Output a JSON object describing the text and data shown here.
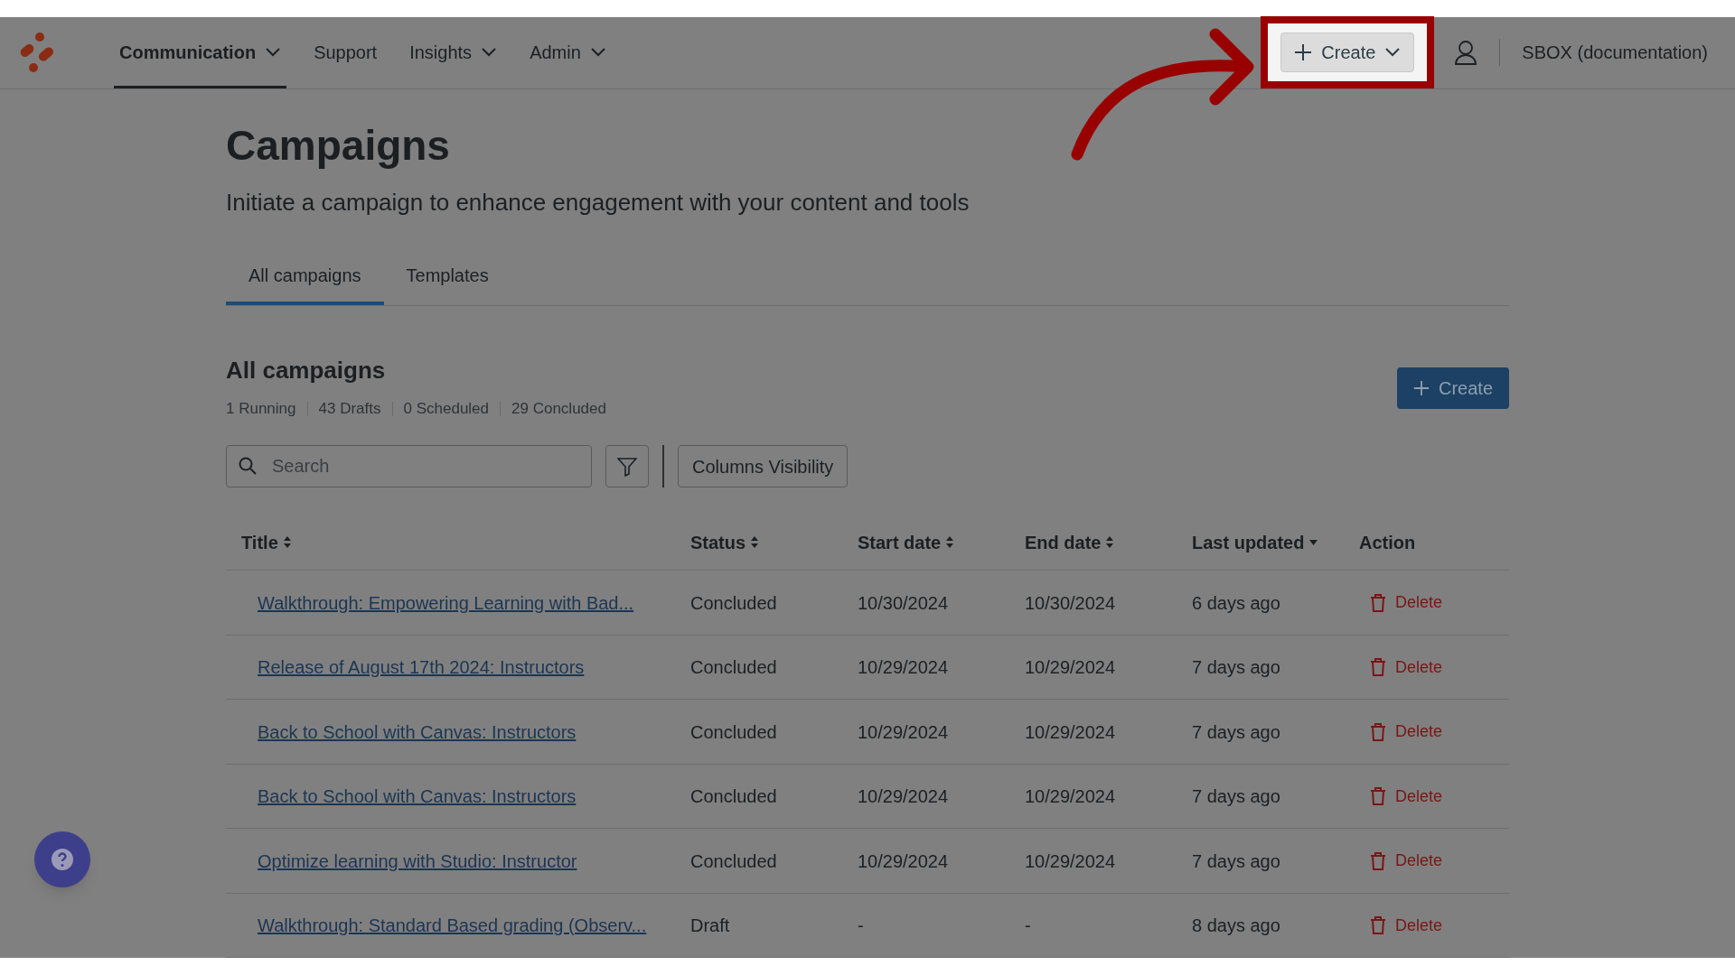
{
  "nav": {
    "items": [
      {
        "label": "Communication",
        "selected": true,
        "dropdown": true
      },
      {
        "label": "Support",
        "selected": false,
        "dropdown": false
      },
      {
        "label": "Insights",
        "selected": false,
        "dropdown": true
      },
      {
        "label": "Admin",
        "selected": false,
        "dropdown": true
      }
    ],
    "create_button": {
      "label": "Create",
      "highlighted": true
    },
    "account": "SBOX (documentation)"
  },
  "page": {
    "title": "Campaigns",
    "subtitle": "Initiate a campaign to enhance engagement with your content and tools"
  },
  "tabs": [
    {
      "label": "All campaigns",
      "selected": true
    },
    {
      "label": "Templates",
      "selected": false
    }
  ],
  "section": {
    "title": "All campaigns",
    "counts": [
      "1 Running",
      "43 Drafts",
      "0 Scheduled",
      "29 Concluded"
    ],
    "create_button": "Create"
  },
  "toolbar": {
    "search": {
      "placeholder": "Search"
    },
    "columns_button": "Columns Visibility"
  },
  "table": {
    "columns": [
      {
        "label": "Title",
        "kind": "sortable"
      },
      {
        "label": "Status",
        "kind": "sortable"
      },
      {
        "label": "Start date",
        "kind": "sortable"
      },
      {
        "label": "End date",
        "kind": "sortable"
      },
      {
        "label": "Last updated",
        "kind": "sorted"
      },
      {
        "label": "Action",
        "kind": "plain"
      }
    ],
    "rows": [
      {
        "title": "Walkthrough: Empowering Learning with Bad...",
        "status": "Concluded",
        "start": "10/30/2024",
        "end": "10/30/2024",
        "updated": "6 days ago",
        "action": "Delete"
      },
      {
        "title": "Release of August 17th 2024: Instructors",
        "status": "Concluded",
        "start": "10/29/2024",
        "end": "10/29/2024",
        "updated": "7 days ago",
        "action": "Delete"
      },
      {
        "title": "Back to School with Canvas: Instructors",
        "status": "Concluded",
        "start": "10/29/2024",
        "end": "10/29/2024",
        "updated": "7 days ago",
        "action": "Delete"
      },
      {
        "title": "Back to School with Canvas: Instructors",
        "status": "Concluded",
        "start": "10/29/2024",
        "end": "10/29/2024",
        "updated": "7 days ago",
        "action": "Delete"
      },
      {
        "title": "Optimize learning with Studio: Instructor",
        "status": "Concluded",
        "start": "10/29/2024",
        "end": "10/29/2024",
        "updated": "7 days ago",
        "action": "Delete"
      },
      {
        "title": "Walkthrough: Standard Based grading (Observ...",
        "status": "Draft",
        "start": "-",
        "end": "-",
        "updated": "8 days ago",
        "action": "Delete"
      }
    ]
  }
}
